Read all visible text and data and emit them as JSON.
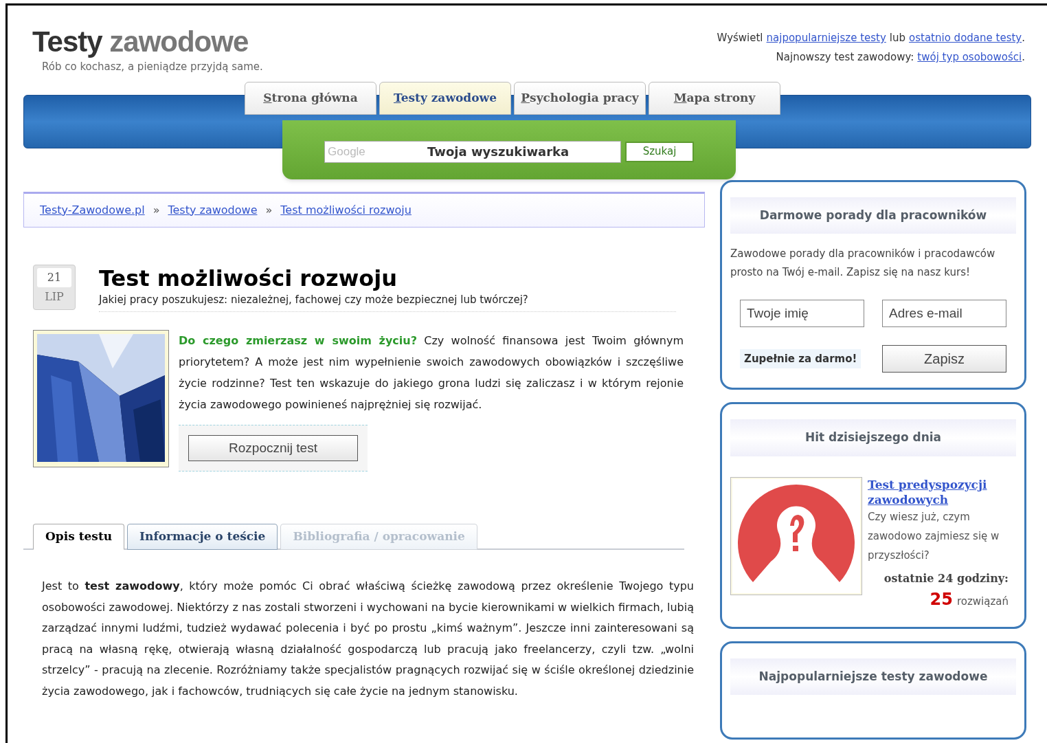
{
  "header": {
    "title_dark": "Testy",
    "title_light": "zawodowe",
    "tagline": "Rób co kochasz, a pieniądze przyjdą same.",
    "top_line_1": [
      {
        "kind": "text",
        "text": "Wyświetl"
      },
      {
        "kind": "link",
        "text": "najpopularniejsze testy"
      },
      {
        "kind": "text",
        "text": "lub"
      },
      {
        "kind": "link",
        "text": "ostatnio dodane testy"
      },
      {
        "kind": "text",
        "text": "."
      }
    ],
    "top_line_2": [
      {
        "kind": "text",
        "text": "Najnowszy test zawodowy:"
      },
      {
        "kind": "link",
        "text": "twój typ osobowości"
      },
      {
        "kind": "text",
        "text": "."
      }
    ]
  },
  "nav_tabs": [
    {
      "label": "Strona główna",
      "selected": false
    },
    {
      "label": "Testy zawodowe",
      "selected": true
    },
    {
      "label": "Psychologia pracy",
      "selected": false
    },
    {
      "label": "Mapa strony",
      "selected": false
    }
  ],
  "search": {
    "logo": "Google",
    "value": "Twoja wyszukiwarka",
    "button": "Szukaj"
  },
  "breadcrumbs": [
    "Testy-Zawodowe.pl",
    "Testy zawodowe",
    "Test możliwości rozwoju"
  ],
  "breadcrumb_separator": "»",
  "article": {
    "date": {
      "day": "21",
      "month": "LIP"
    },
    "title": "Test możliwości rozwoju",
    "subtitle": "Jakiej pracy poszukujesz: niezależnej, fachowej czy może bezpiecznej lub twórczej?",
    "intro_lead": "Do czego zmierzasz w swoim życiu?",
    "intro": "Czy wolność finansowa jest Twoim głównym priorytetem? A może jest nim wypełnienie swoich zawodowych obowiązków i szczęśliwe życie rodzinne? Test ten wskazuje do jakiego grona ludzi się zaliczasz i w którym rejonie życia zawodowego powinieneś najprężniej się rozwijać.",
    "start_button": "Rozpocznij test"
  },
  "content_tabs": [
    {
      "label": "Opis testu",
      "selected": true,
      "disabled": false
    },
    {
      "label": "Informacje o teście",
      "selected": false,
      "disabled": false
    },
    {
      "label": "Bibliografia / opracowanie",
      "selected": false,
      "disabled": true
    }
  ],
  "description": "Jest to **test zawodowy**, który może pomóc Ci obrać właściwą ścieżkę zawodową przez określenie Twojego typu osobowości zawodowej. Niektórzy z nas zostali stworzeni i wychowani na bycie kierownikami w wielkich firmach, lubią zarządzać innymi ludźmi, tudzież wydawać polecenia i być po prostu „kimś ważnym”. Jeszcze inni zainteresowani są pracą na własną rękę, otwierają własną działalność gospodarczą lub pracują jako freelancerzy, czyli tzw. „wolni strzelcy” - pracują na zlecenie. Rozróżniamy także specjalistów pragnących rozwijać się w ściśle określonej dziedzinie życia zawodowego, jak i fachowców, trudniących się całe życie na jednym stanowisku.",
  "sidebar": [
    {
      "kind": "newsletter",
      "title": "Darmowe porady dla pracowników",
      "text": "Zawodowe porady dla pracowników i pracodawców prosto na Twój e-mail. Zapisz się na nasz kurs!",
      "name_placeholder": "Twoje imię",
      "email_placeholder": "Adres e-mail",
      "free_label": "Zupełnie za darmo!",
      "button": "Zapisz"
    },
    {
      "kind": "hit",
      "title": "Hit dzisiejszego dnia",
      "link": "Test predyspozycji zawodowych",
      "text": "Czy wiesz już, czym zawodowo zajmiesz się w przyszłości?",
      "stat_label": "ostatnie 24 godziny:",
      "stat_count": "25",
      "stat_unit": "rozwiązań"
    },
    {
      "kind": "list",
      "title": "Najpopularniejsze testy zawodowe"
    }
  ]
}
